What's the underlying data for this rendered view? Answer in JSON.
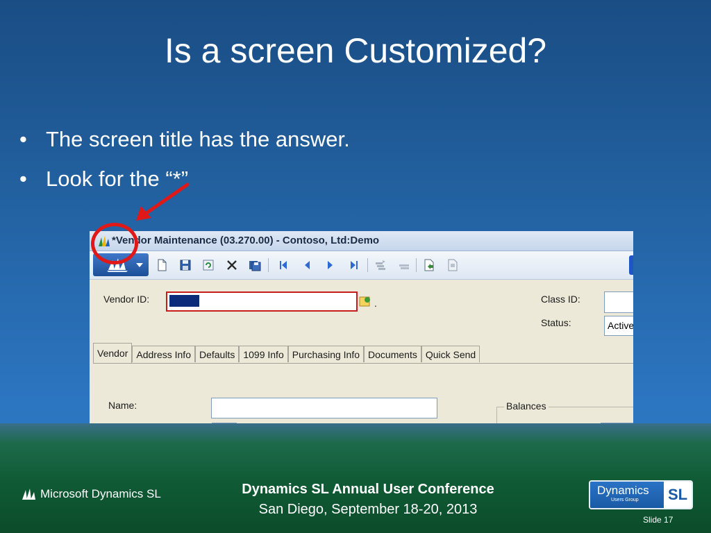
{
  "slide": {
    "title": "Is a screen Customized?",
    "bullets": [
      "The screen title has the answer.",
      "Look for the “*”"
    ],
    "footer": {
      "brand": "Microsoft Dynamics SL",
      "conference_line1": "Dynamics SL Annual User Conference",
      "conference_line2": "San Diego, September 18-20, 2013",
      "badge_main": "Dynamics",
      "badge_sub": "Users Group",
      "badge_short": "SL",
      "slide_number": "Slide 17"
    }
  },
  "window": {
    "title": "*Vendor Maintenance (03.270.00) - Contoso, Ltd:Demo",
    "toolbar_icons": [
      "new-icon",
      "save-icon",
      "refresh-icon",
      "delete-icon",
      "save-all-icon",
      "first-record-icon",
      "previous-record-icon",
      "next-record-icon",
      "last-record-icon",
      "insert-icon",
      "copy-icon",
      "export-icon",
      "import-icon"
    ],
    "labels": {
      "vendor_id": "Vendor ID:",
      "class_id": "Class ID:",
      "status": "Status:",
      "name": "Name:",
      "balances": "Balances"
    },
    "values": {
      "status": "Active",
      "vendor_id_dot": "."
    },
    "tabs": [
      "Vendor",
      "Address Info",
      "Defaults",
      "1099 Info",
      "Purchasing Info",
      "Documents",
      "Quick Send"
    ]
  },
  "colors": {
    "annotation_red": "#e01818",
    "title_bar": "#c5d6ec",
    "form_background": "#ece9d8"
  }
}
